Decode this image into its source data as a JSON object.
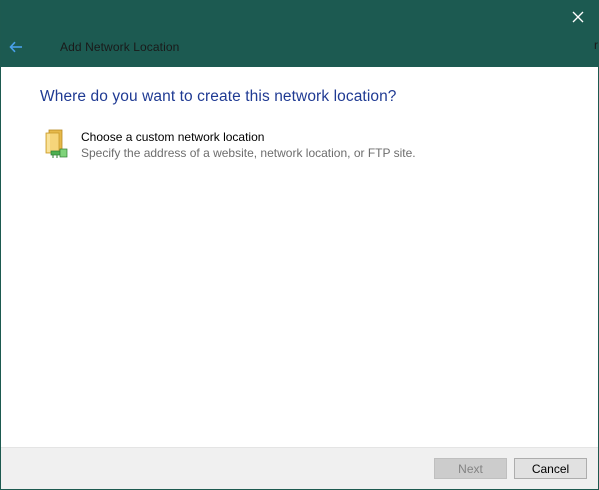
{
  "window": {
    "title": "Add Network Location",
    "edge_glyph": "r",
    "close_icon": "close-icon",
    "back_icon": "back-arrow-icon",
    "accent_color": "#1c5a51"
  },
  "main": {
    "heading": "Where do you want to create this network location?",
    "options": [
      {
        "icon": "network-folder-icon",
        "title": "Choose a custom network location",
        "description": "Specify the address of a website, network location, or FTP site."
      }
    ]
  },
  "footer": {
    "next_label": "Next",
    "next_enabled": false,
    "cancel_label": "Cancel"
  }
}
